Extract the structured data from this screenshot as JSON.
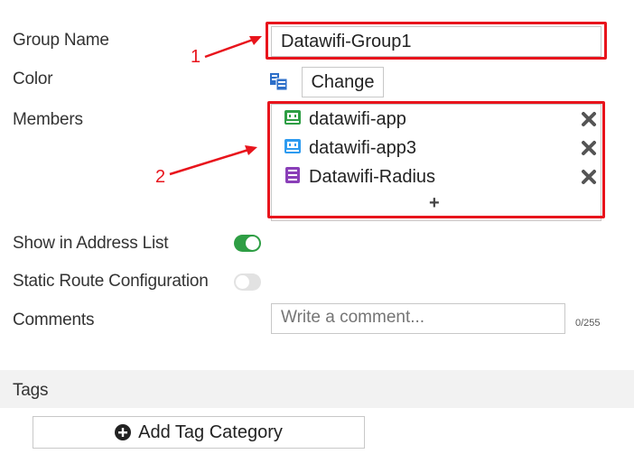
{
  "form": {
    "group_name_label": "Group Name",
    "group_name_value": "Datawifi-Group1",
    "color_label": "Color",
    "change_button": "Change",
    "members_label": "Members",
    "members": [
      {
        "name": "datawifi-app",
        "icon": "green-interface-icon",
        "color": "#2e9e44"
      },
      {
        "name": "datawifi-app3",
        "icon": "blue-interface-icon",
        "color": "#2d9bf0"
      },
      {
        "name": "Datawifi-Radius",
        "icon": "purple-server-icon",
        "color": "#8a3fb8"
      }
    ],
    "add_member": "+",
    "show_in_address_list_label": "Show in Address List",
    "show_in_address_list_enabled": true,
    "static_route_label": "Static Route Configuration",
    "static_route_enabled": false,
    "comments_label": "Comments",
    "comments_placeholder": "Write a comment...",
    "comments_counter": "0/255"
  },
  "tags": {
    "section_label": "Tags",
    "add_tag_button": "Add Tag Category"
  },
  "annotations": {
    "marker_1": "1",
    "marker_2": "2",
    "color": "#e8141c"
  }
}
